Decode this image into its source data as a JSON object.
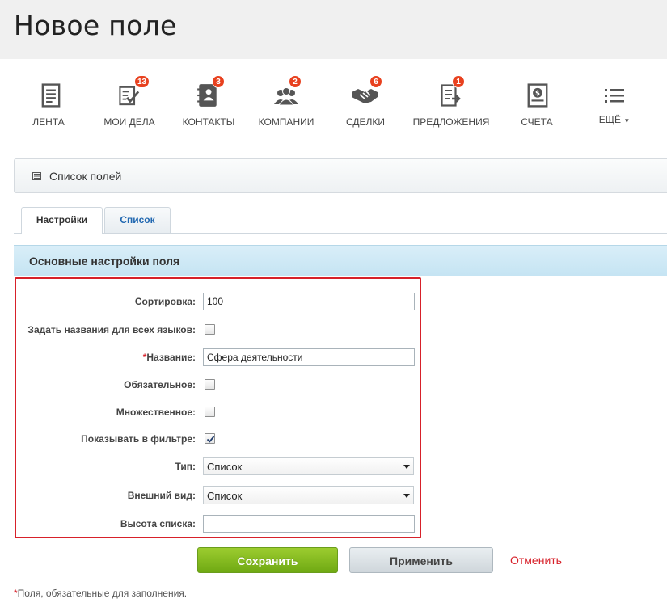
{
  "page": {
    "title": "Новое поле"
  },
  "toolbar": {
    "items": [
      {
        "label": "ЛЕНТА",
        "icon": "feed-icon",
        "badge": null
      },
      {
        "label": "МОИ ДЕЛА",
        "icon": "tasks-icon",
        "badge": "13"
      },
      {
        "label": "КОНТАКТЫ",
        "icon": "contacts-icon",
        "badge": "3"
      },
      {
        "label": "КОМПАНИИ",
        "icon": "companies-icon",
        "badge": "2"
      },
      {
        "label": "СДЕЛКИ",
        "icon": "deals-icon",
        "badge": "6"
      },
      {
        "label": "ПРЕДЛОЖЕНИЯ",
        "icon": "quotes-icon",
        "badge": "1"
      },
      {
        "label": "СЧЕТА",
        "icon": "invoices-icon",
        "badge": null
      },
      {
        "label": "ЕЩЁ",
        "icon": "menu-list-icon",
        "badge": null
      }
    ]
  },
  "panel": {
    "label": "Список полей",
    "icon": "list-icon"
  },
  "tabs": [
    {
      "label": "Настройки",
      "active": true
    },
    {
      "label": "Список",
      "active": false
    }
  ],
  "section": {
    "title": "Основные настройки поля"
  },
  "form": {
    "sort": {
      "label": "Сортировка:",
      "value": "100"
    },
    "all_languages": {
      "label": "Задать названия для всех языков:",
      "checked": false
    },
    "name": {
      "required_mark": "*",
      "label": "Название:",
      "value": "Сфера деятельности"
    },
    "mandatory": {
      "label": "Обязательное:",
      "checked": false
    },
    "multiple": {
      "label": "Множественное:",
      "checked": false
    },
    "show_in_filter": {
      "label": "Показывать в фильтре:",
      "checked": true
    },
    "type": {
      "label": "Тип:",
      "selected": "Список"
    },
    "appearance": {
      "label": "Внешний вид:",
      "selected": "Список"
    },
    "list_height": {
      "label": "Высота списка:",
      "value": ""
    }
  },
  "buttons": {
    "save": "Сохранить",
    "apply": "Применить",
    "cancel": "Отменить"
  },
  "footnote": {
    "mark": "*",
    "text": "Поля, обязательные для заполнения."
  },
  "colors": {
    "required": "#d7212a",
    "badge": "#e8411f",
    "save_button": "#7cb51e",
    "section_header": "#cfe8f5",
    "link_tab": "#2067b0"
  }
}
